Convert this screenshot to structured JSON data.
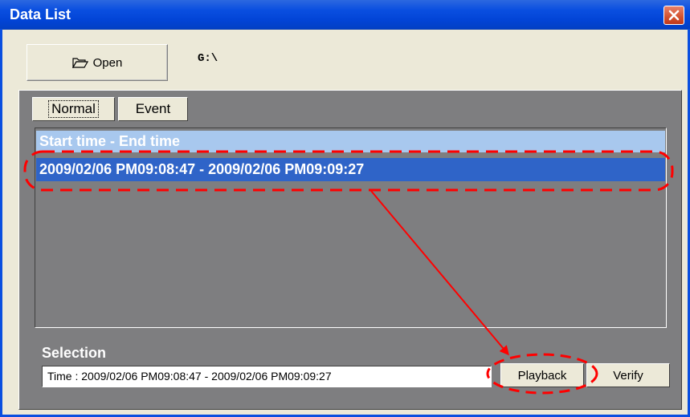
{
  "window": {
    "title": "Data List",
    "close_icon": "close-icon",
    "frame_color": "#0A4FE0"
  },
  "toolbar": {
    "open_label": "Open",
    "open_icon": "folder-open-icon",
    "path": "G:\\"
  },
  "tabs": [
    {
      "label": "Normal",
      "selected": true
    },
    {
      "label": "Event",
      "selected": false
    }
  ],
  "list": {
    "header": "Start time - End time",
    "rows": [
      {
        "text": "2009/02/06 PM09:08:47 - 2009/02/06 PM09:09:27",
        "selected": true
      }
    ]
  },
  "selection": {
    "label": "Selection",
    "value": "Time : 2009/02/06 PM09:08:47 - 2009/02/06 PM09:09:27"
  },
  "buttons": {
    "playback_label": "Playback",
    "verify_label": "Verify"
  },
  "annotation": {
    "color": "#FF0000",
    "style": "dashed-ellipse-and-arrow"
  }
}
